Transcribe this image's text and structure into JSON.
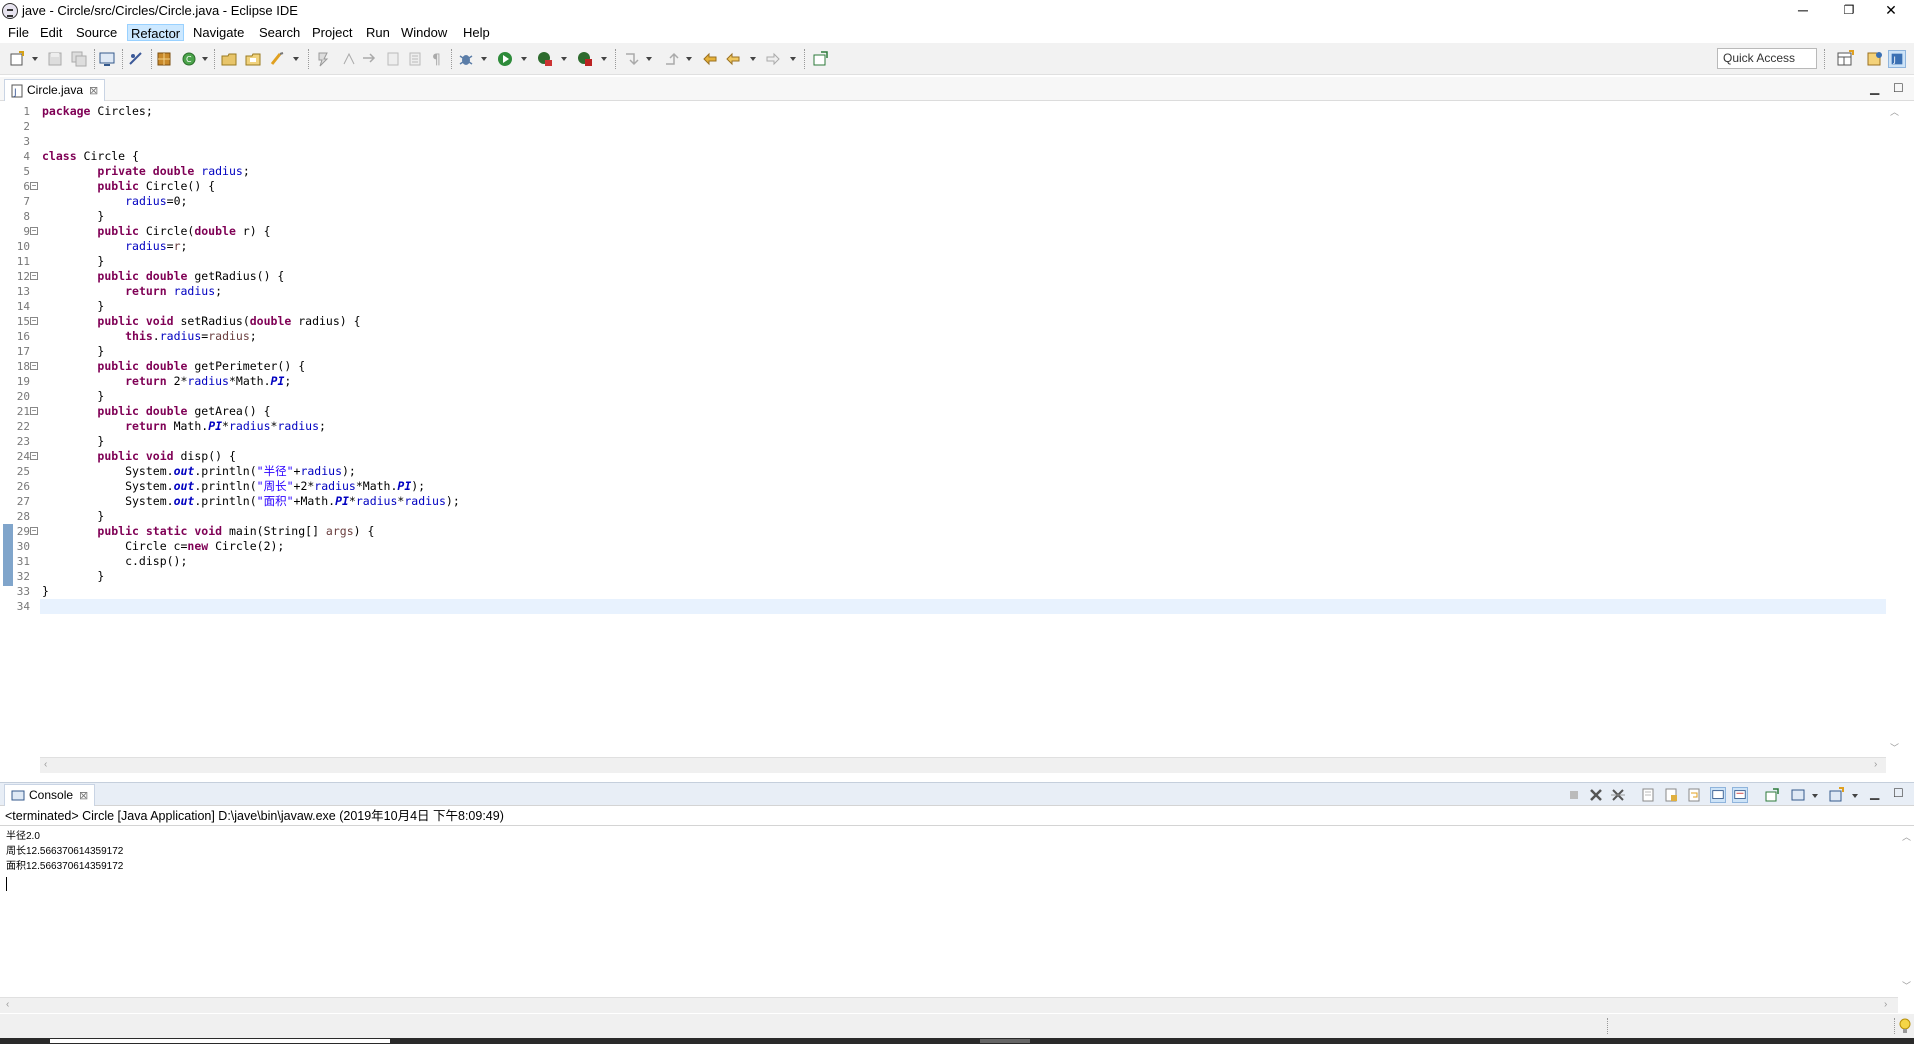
{
  "window": {
    "title": "jave - Circle/src/Circles/Circle.java - Eclipse IDE",
    "minimize": "─",
    "restore": "❐",
    "close": "✕"
  },
  "menu": [
    "File",
    "Edit",
    "Source",
    "Refactor",
    "Navigate",
    "Search",
    "Project",
    "Run",
    "Window",
    "Help"
  ],
  "toolbar": {
    "quick_access_placeholder": "Quick Access"
  },
  "editor": {
    "tab_label": "Circle.java",
    "line_numbers": [
      "1",
      "2",
      "3",
      "4",
      "5",
      "6",
      "7",
      "8",
      "9",
      "10",
      "11",
      "12",
      "13",
      "14",
      "15",
      "16",
      "17",
      "18",
      "19",
      "20",
      "21",
      "22",
      "23",
      "24",
      "25",
      "26",
      "27",
      "28",
      "29",
      "30",
      "31",
      "32",
      "33",
      "34"
    ],
    "lines": [
      "package Circles;",
      "",
      "",
      "class Circle {",
      "        private double radius;",
      "        public Circle() {",
      "            radius=0;",
      "        }",
      "        public Circle(double r) {",
      "            radius=r;",
      "        }",
      "        public double getRadius() {",
      "            return radius;",
      "        }",
      "        public void setRadius(double radius) {",
      "            this.radius=radius;",
      "        }",
      "        public double getPerimeter() {",
      "            return 2*radius*Math.PI;",
      "        }",
      "        public double getArea() {",
      "            return Math.PI*radius*radius;",
      "        }",
      "        public void disp() {",
      "            System.out.println(\"半径\"+radius);",
      "            System.out.println(\"周长\"+2*radius*Math.PI);",
      "            System.out.println(\"面积\"+Math.PI*radius*radius);",
      "        }",
      "        public static void main(String[] args) {",
      "            Circle c=new Circle(2);",
      "            c.disp();",
      "        }",
      "}",
      ""
    ],
    "fold_lines": [
      "6",
      "9",
      "12",
      "15",
      "18",
      "21",
      "24",
      "29"
    ]
  },
  "console": {
    "tab_label": "Console",
    "status": "<terminated> Circle [Java Application] D:\\jave\\bin\\javaw.exe (2019年10月4日 下午8:09:49)",
    "output": [
      "半径2.0",
      "周长12.566370614359172",
      "面积12.566370614359172"
    ]
  },
  "colors": {
    "keyword": "#7f0055",
    "field": "#0000c0",
    "string": "#2a00ff",
    "parameter": "#6a3e3e",
    "line_number": "#787878"
  }
}
